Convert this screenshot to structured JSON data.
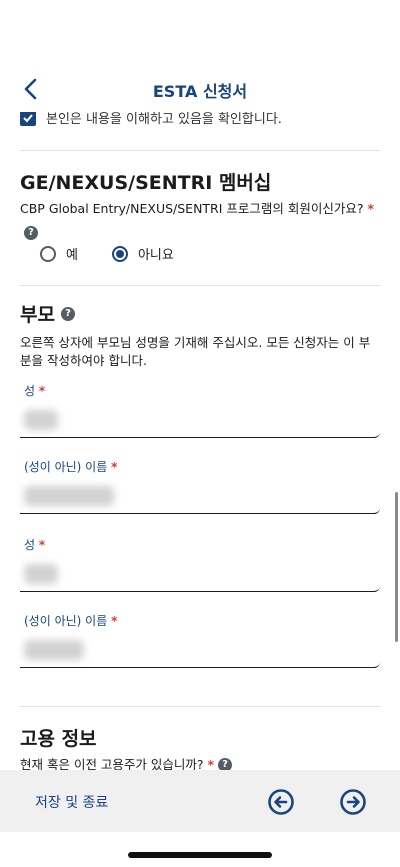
{
  "header": {
    "title": "ESTA 신청서"
  },
  "consent": {
    "text": "본인은 내용을 이해하고 있음을 확인합니다."
  },
  "membership": {
    "title": "GE/NEXUS/SENTRI 멤버십",
    "question": "CBP Global Entry/NEXUS/SENTRI 프로그램의 회원이신가요?",
    "required_mark": "*",
    "options": [
      {
        "label": "예",
        "selected": false
      },
      {
        "label": "아니요",
        "selected": true
      }
    ]
  },
  "parents": {
    "title": "부모",
    "description": "오른쪽 상자에 부모님 성명을 기재해 주십시오. 모든 신청자는 이 부분을 작성하여야 합니다.",
    "fields": [
      {
        "label": "성",
        "required_mark": "*"
      },
      {
        "label": "(성이 아닌) 이름",
        "required_mark": "*"
      },
      {
        "label": "성",
        "required_mark": "*"
      },
      {
        "label": "(성이 아닌) 이름",
        "required_mark": "*"
      }
    ]
  },
  "employment": {
    "title": "고용 정보",
    "question": "현재 혹은 이전 고용주가 있습니까?",
    "required_mark": "*"
  },
  "footer": {
    "save_label": "저장 및 종료"
  },
  "colors": {
    "primary": "#1a4480",
    "required": "#d83933",
    "footer_bg": "#f0f0f0"
  }
}
